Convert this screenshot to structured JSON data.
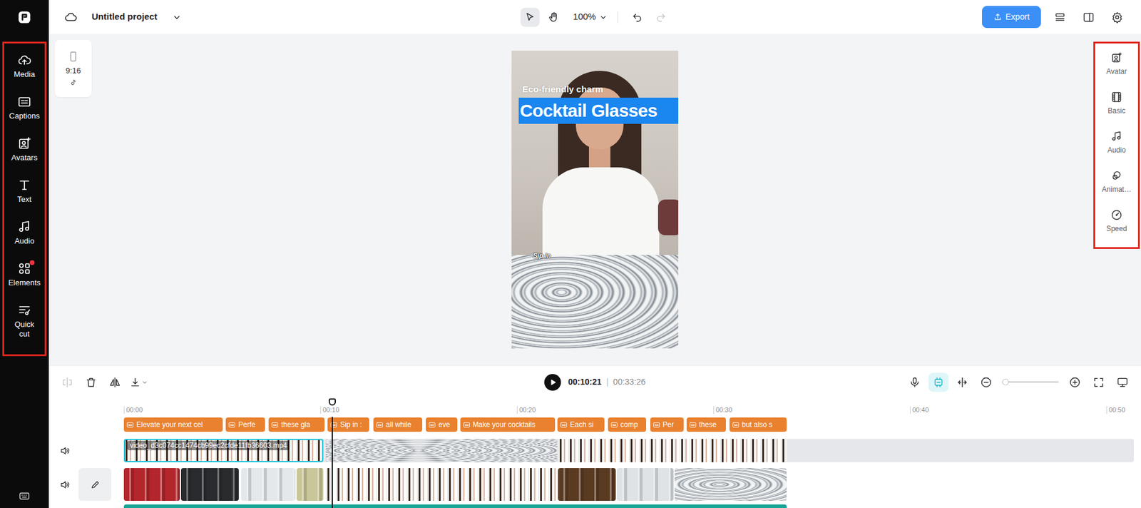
{
  "sidebar": {
    "annotated": true,
    "items": [
      {
        "label": "Media",
        "badge": false
      },
      {
        "label": "Captions",
        "badge": false
      },
      {
        "label": "Avatars",
        "badge": false
      },
      {
        "label": "Text",
        "badge": false
      },
      {
        "label": "Audio",
        "badge": false
      },
      {
        "label": "Elements",
        "badge": true
      },
      {
        "label": "Quick cut",
        "badge": false
      }
    ]
  },
  "topbar": {
    "project_title": "Untitled project",
    "tools": [
      {
        "selected": true
      },
      {
        "selected": false
      }
    ],
    "zoom": "100%",
    "undo_enabled": true,
    "redo_enabled": false,
    "export_label": "Export"
  },
  "canvas": {
    "aspect_ratio": "9:16",
    "overlays": [
      {
        "text": "Eco-friendly charm",
        "selected": false
      },
      {
        "text": "Cocktail Glasses",
        "selected": true
      }
    ],
    "caption": "Sip in"
  },
  "right_panel": {
    "annotated": true,
    "items": [
      {
        "label": "Avatar"
      },
      {
        "label": "Basic"
      },
      {
        "label": "Audio"
      },
      {
        "label": "Animat…"
      },
      {
        "label": "Speed"
      }
    ]
  },
  "timeline": {
    "split_enabled": false,
    "current_time": "00:10:21",
    "separator": "|",
    "duration": "00:33:26",
    "playhead_seconds": 10.6,
    "snap_on": true,
    "zoom_level": 0.05,
    "ruler": [
      {
        "label": "00:00",
        "seconds": 0
      },
      {
        "label": "00:10",
        "seconds": 10
      },
      {
        "label": "00:20",
        "seconds": 20
      },
      {
        "label": "00:30",
        "seconds": 30
      },
      {
        "label": "00:40",
        "seconds": 40
      },
      {
        "label": "00:50",
        "seconds": 50
      }
    ],
    "captions": [
      {
        "text": "Elevate your next cel",
        "start": 0,
        "end": 5.04
      },
      {
        "text": "Perfe",
        "start": 5.19,
        "end": 7.19
      },
      {
        "text": "these gla",
        "start": 7.37,
        "end": 10.22
      },
      {
        "text": "Sip in :",
        "start": 10.37,
        "end": 12.48
      },
      {
        "text": "all while",
        "start": 12.7,
        "end": 15.19
      },
      {
        "text": "eve",
        "start": 15.37,
        "end": 16.96
      },
      {
        "text": "Make your cocktails",
        "start": 17.11,
        "end": 21.93
      },
      {
        "text": "Each si",
        "start": 22.07,
        "end": 24.44
      },
      {
        "text": "comp",
        "start": 24.63,
        "end": 26.59
      },
      {
        "text": "Per",
        "start": 26.78,
        "end": 28.48
      },
      {
        "text": "these",
        "start": 28.63,
        "end": 30.63
      },
      {
        "text": "but also s",
        "start": 30.81,
        "end": 33.74
      }
    ],
    "tracks": [
      {
        "muted": false,
        "edit_button": false,
        "clips": [
          {
            "kind": "person",
            "start": 0,
            "end": 10.15,
            "selected": true,
            "label": "video_d3c074cc1474cb99ec2cfde11fb36603.mp4"
          },
          {
            "kind": "texture",
            "start": 10.26,
            "end": 22.07,
            "selected": false
          },
          {
            "kind": "person",
            "start": 22.1,
            "end": 33.74,
            "selected": false
          }
        ]
      },
      {
        "muted": false,
        "edit_button": true,
        "clips": [
          {
            "kind": "product",
            "start": 0,
            "end": 2.85,
            "selected": false,
            "color": "#b3262b"
          },
          {
            "kind": "product",
            "start": 2.92,
            "end": 5.85,
            "selected": false,
            "color": "#2a2b2e"
          },
          {
            "kind": "product",
            "start": 5.96,
            "end": 8.74,
            "selected": false,
            "color": "#e4e8eb"
          },
          {
            "kind": "product",
            "start": 8.8,
            "end": 10.15,
            "selected": false,
            "color": "#c9c79a"
          },
          {
            "kind": "person",
            "start": 10.26,
            "end": 22.07,
            "selected": false
          },
          {
            "kind": "product",
            "start": 22.1,
            "end": 25.04,
            "selected": false,
            "color": "#5a3b22"
          },
          {
            "kind": "product",
            "start": 25.1,
            "end": 27.96,
            "selected": false,
            "color": "#dfe3e6"
          },
          {
            "kind": "texture",
            "start": 28.04,
            "end": 33.74,
            "selected": false
          }
        ]
      }
    ],
    "partial_track": {
      "start": 0,
      "end": 33.74
    }
  }
}
